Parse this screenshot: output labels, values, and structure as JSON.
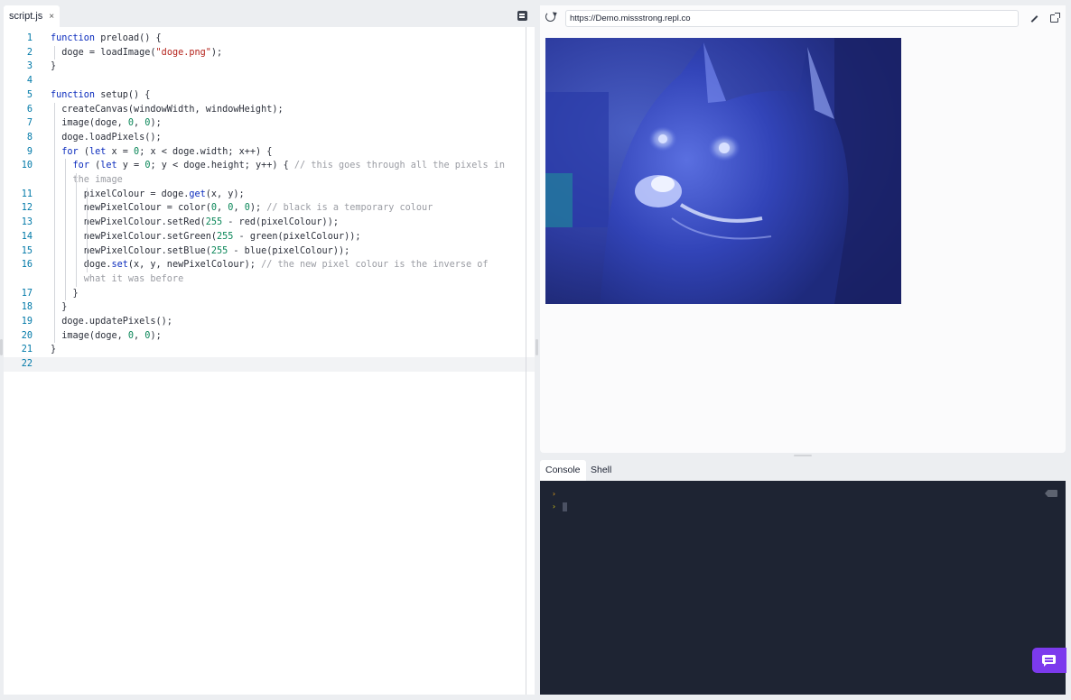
{
  "editor": {
    "tab_label": "script.js",
    "tab_close": "×",
    "lines": [
      {
        "n": "1",
        "segs": [
          [
            "kw",
            "function"
          ],
          [
            "",
            "preload() {"
          ]
        ]
      },
      {
        "n": "2",
        "segs": [
          [
            "",
            "  doge = loadImage("
          ],
          [
            "str",
            "\"doge.png\""
          ],
          [
            "",
            ");"
          ]
        ]
      },
      {
        "n": "3",
        "segs": [
          [
            "",
            "}"
          ]
        ]
      },
      {
        "n": "4",
        "segs": []
      },
      {
        "n": "5",
        "segs": [
          [
            "kw",
            "function"
          ],
          [
            "",
            "setup() {"
          ]
        ]
      },
      {
        "n": "6",
        "segs": [
          [
            "",
            "  createCanvas(windowWidth, windowHeight);"
          ]
        ]
      },
      {
        "n": "7",
        "segs": [
          [
            "",
            "  image(doge, "
          ],
          [
            "num",
            "0"
          ],
          [
            "",
            ", "
          ],
          [
            "num",
            "0"
          ],
          [
            "",
            ");"
          ]
        ]
      },
      {
        "n": "8",
        "segs": [
          [
            "",
            "  doge.loadPixels();"
          ]
        ]
      },
      {
        "n": "9",
        "segs": [
          [
            "",
            "  "
          ],
          [
            "kw",
            "for"
          ],
          [
            "",
            " ("
          ],
          [
            "kw",
            "let"
          ],
          [
            "",
            " x = "
          ],
          [
            "num",
            "0"
          ],
          [
            "",
            "; x < doge.width; x++) {"
          ]
        ]
      },
      {
        "n": "10",
        "segs": [
          [
            "",
            "    "
          ],
          [
            "kw",
            "for"
          ],
          [
            "",
            " ("
          ],
          [
            "kw",
            "let"
          ],
          [
            "",
            " y = "
          ],
          [
            "num",
            "0"
          ],
          [
            "",
            "; y < doge.height; y++) { "
          ],
          [
            "cmt",
            "// this goes through all the pixels in"
          ]
        ]
      },
      {
        "n": "",
        "segs": [
          [
            "cmt",
            "    the image"
          ]
        ]
      },
      {
        "n": "11",
        "segs": [
          [
            "",
            "      pixelColour = doge."
          ],
          [
            "fn",
            "get"
          ],
          [
            "",
            "(x, y);"
          ]
        ]
      },
      {
        "n": "12",
        "segs": [
          [
            "",
            "      newPixelColour = color("
          ],
          [
            "num",
            "0"
          ],
          [
            "",
            ", "
          ],
          [
            "num",
            "0"
          ],
          [
            "",
            ", "
          ],
          [
            "num",
            "0"
          ],
          [
            "",
            "); "
          ],
          [
            "cmt",
            "// black is a temporary colour"
          ]
        ]
      },
      {
        "n": "13",
        "segs": [
          [
            "",
            "      newPixelColour.setRed("
          ],
          [
            "num",
            "255"
          ],
          [
            "",
            " - red(pixelColour));"
          ]
        ]
      },
      {
        "n": "14",
        "segs": [
          [
            "",
            "      newPixelColour.setGreen("
          ],
          [
            "num",
            "255"
          ],
          [
            "",
            " - green(pixelColour));"
          ]
        ]
      },
      {
        "n": "15",
        "segs": [
          [
            "",
            "      newPixelColour.setBlue("
          ],
          [
            "num",
            "255"
          ],
          [
            "",
            " - blue(pixelColour));"
          ]
        ]
      },
      {
        "n": "16",
        "segs": [
          [
            "",
            "      doge."
          ],
          [
            "fn",
            "set"
          ],
          [
            "",
            "(x, y, newPixelColour); "
          ],
          [
            "cmt",
            "// the new pixel colour is the inverse of"
          ]
        ]
      },
      {
        "n": "",
        "segs": [
          [
            "cmt",
            "      what it was before"
          ]
        ]
      },
      {
        "n": "17",
        "segs": [
          [
            "",
            "    }"
          ]
        ]
      },
      {
        "n": "18",
        "segs": [
          [
            "",
            "  }"
          ]
        ]
      },
      {
        "n": "19",
        "segs": [
          [
            "",
            "  doge.updatePixels();"
          ]
        ]
      },
      {
        "n": "20",
        "segs": [
          [
            "",
            "  image(doge, "
          ],
          [
            "num",
            "0"
          ],
          [
            "",
            ", "
          ],
          [
            "num",
            "0"
          ],
          [
            "",
            ");"
          ]
        ]
      },
      {
        "n": "21",
        "segs": [
          [
            "",
            "}"
          ]
        ]
      },
      {
        "n": "22",
        "segs": [],
        "active": true
      }
    ]
  },
  "webview": {
    "url": "https://Demo.missstrong.repl.co"
  },
  "console": {
    "tabs": [
      "Console",
      "Shell"
    ],
    "active_tab": "Console",
    "prompt_symbol": "›"
  },
  "colors": {
    "accent": "#7c3aed",
    "console_bg": "#1e2433",
    "prompt_orange": "#e8a317",
    "keyword": "#0a2bbd",
    "string": "#b4221b",
    "number": "#098658",
    "comment": "#9a9ca3"
  }
}
